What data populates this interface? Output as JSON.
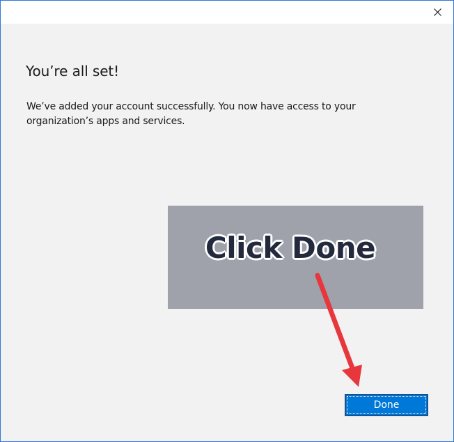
{
  "window": {
    "close_icon": "close-icon"
  },
  "content": {
    "heading": "You’re all set!",
    "message": "We’ve added your account successfully. You now have access to your organization’s apps and services."
  },
  "annotation": {
    "callout_text": "Click Done",
    "box_color": "#9fa2ab",
    "arrow_color": "#e8363d"
  },
  "footer": {
    "done_label": "Done",
    "accent_color": "#0078d7"
  }
}
